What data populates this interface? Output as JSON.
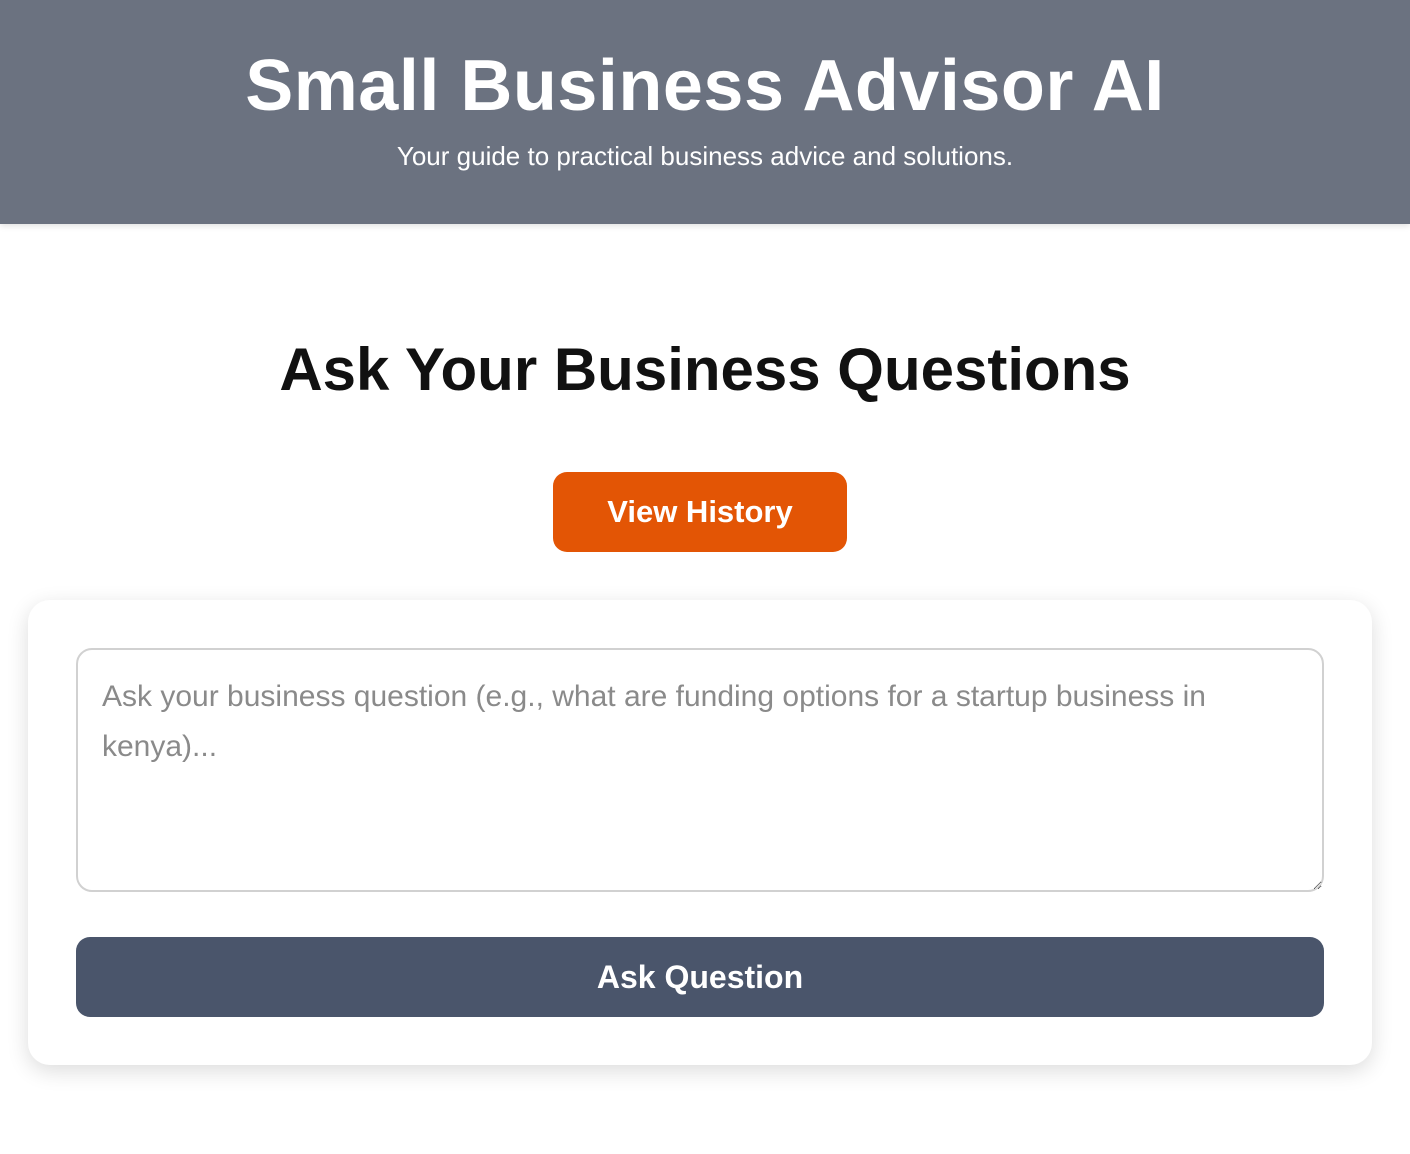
{
  "header": {
    "title": "Small Business Advisor AI",
    "subtitle": "Your guide to practical business advice and solutions."
  },
  "main": {
    "heading": "Ask Your Business Questions",
    "history_button_label": "View History",
    "question_input": {
      "value": "",
      "placeholder": "Ask your business question (e.g., what are funding options for a startup business in kenya)..."
    },
    "ask_button_label": "Ask Question"
  },
  "colors": {
    "header_bg": "#6b7280",
    "history_button_bg": "#e35505",
    "ask_button_bg": "#4a556b"
  }
}
